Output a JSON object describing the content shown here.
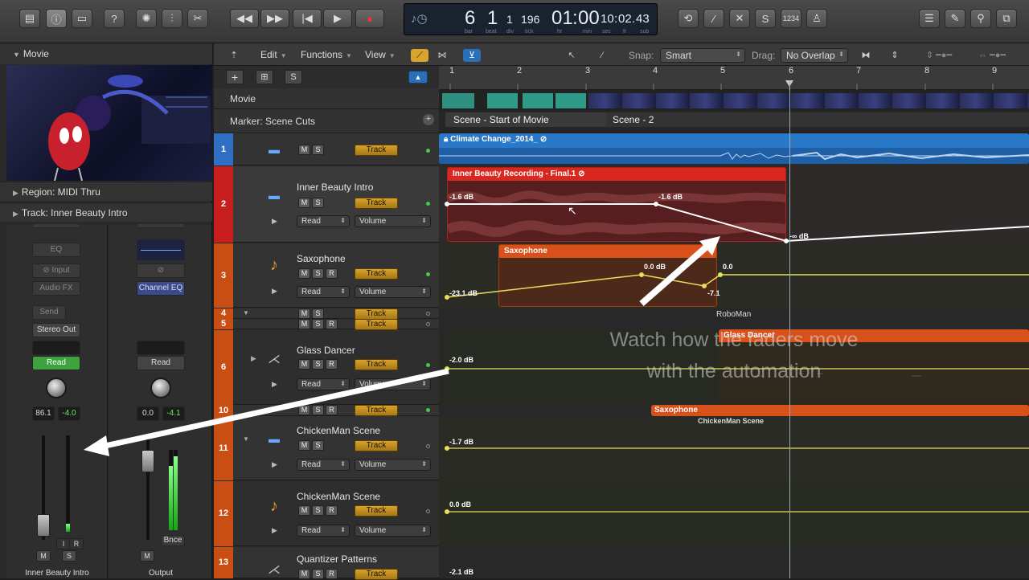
{
  "toolbar": {
    "lcd": {
      "bar": "6",
      "beat": "1",
      "div": "1",
      "tick": "196",
      "hr": "01",
      "min": "00",
      "sec": "10",
      "fr": "02",
      "sub": "43",
      "labels": {
        "bar": "bar",
        "beat": "beat",
        "div": "div",
        "tick": "tick",
        "hr": "hr",
        "min": "min",
        "sec": "sec",
        "fr": "fr",
        "sub": "sub"
      }
    },
    "counter": "1234"
  },
  "left_panel": {
    "movie_header": "Movie",
    "region": "Region: MIDI Thru",
    "track": "Track:  Inner Beauty Intro",
    "strip1": {
      "eq": "EQ",
      "input": "Input",
      "audio_fx": "Audio FX",
      "send": "Send",
      "output": "Stereo Out",
      "mode": "Read",
      "pan": "86.1",
      "gain": "-4.0",
      "mute": "M",
      "solo": "S",
      "name": "Inner Beauty Intro",
      "i": "I",
      "r": "R"
    },
    "strip2": {
      "eq": "Channel EQ",
      "mode": "Read",
      "pan": "0.0",
      "gain": "-4.1",
      "mute": "M",
      "bounce": "Bnce",
      "name": "Output"
    }
  },
  "tracks_toolbar": {
    "edit": "Edit",
    "functions": "Functions",
    "view": "View",
    "snap_label": "Snap:",
    "snap": "Smart",
    "drag_label": "Drag:",
    "drag": "No Overlap"
  },
  "header_buttons": {
    "plus": "+",
    "s": "S"
  },
  "global_tracks": {
    "movie": "Movie",
    "marker": "Marker: Scene Cuts"
  },
  "tracks": [
    {
      "num": "1",
      "name": "",
      "m": "M",
      "s": "S",
      "btn": "Track",
      "color": "#2f6fc4"
    },
    {
      "num": "2",
      "name": "Inner Beauty Intro",
      "m": "M",
      "s": "S",
      "btn": "Track",
      "mode": "Read",
      "param": "Volume",
      "color": "#d02020"
    },
    {
      "num": "3",
      "name": "Saxophone",
      "m": "M",
      "s": "S",
      "r": "R",
      "btn": "Track",
      "mode": "Read",
      "param": "Volume",
      "color": "#c84e14"
    },
    {
      "num": "4",
      "m": "M",
      "s": "S",
      "btn": "Track",
      "color": "#c84e14"
    },
    {
      "num": "5",
      "m": "M",
      "s": "S",
      "r": "R",
      "btn": "Track",
      "color": "#c84e14"
    },
    {
      "num": "6",
      "name": "Glass Dancer",
      "m": "M",
      "s": "S",
      "r": "R",
      "btn": "Track",
      "mode": "Read",
      "param": "Volume",
      "color": "#c84e14"
    },
    {
      "num": "10",
      "m": "M",
      "s": "S",
      "r": "R",
      "btn": "Track",
      "color": "#c84e14"
    },
    {
      "num": "11",
      "name": "ChickenMan Scene",
      "m": "M",
      "s": "S",
      "btn": "Track",
      "mode": "Read",
      "param": "Volume",
      "color": "#c84e14"
    },
    {
      "num": "12",
      "name": "ChickenMan Scene",
      "m": "M",
      "s": "S",
      "r": "R",
      "btn": "Track",
      "mode": "Read",
      "param": "Volume",
      "color": "#c84e14"
    },
    {
      "num": "13",
      "name": "Quantizer Patterns",
      "m": "M",
      "s": "S",
      "r": "R",
      "btn": "Track",
      "color": "#c84e14"
    }
  ],
  "ruler": {
    "bars": [
      "1",
      "2",
      "3",
      "4",
      "5",
      "6",
      "7",
      "8",
      "9"
    ]
  },
  "markers": {
    "m1": "Scene - Start of Movie",
    "m2": "Scene - 2"
  },
  "regions": {
    "climate": "Climate Change_2014_",
    "inner": "Inner Beauty Recording - Final.1",
    "sax": "Saxophone",
    "glass": "Glass Dancer",
    "sax2": "Saxophone",
    "roboman": "RoboMan",
    "chicken": "ChickenMan Scene"
  },
  "automation_labels": {
    "a1": "-1.6 dB",
    "a2": "-1.6 dB",
    "a3": "-∞ dB",
    "b1": "-23.1 dB",
    "b2": "0.0 dB",
    "b3": "-7.1",
    "b4": "0.0",
    "c1": "-2.0 dB",
    "d1": "-1.7 dB",
    "e1": "0.0 dB",
    "f1": "-2.1 dB"
  },
  "caption": {
    "line1": "Watch how the faders move",
    "line2": "with the automation"
  },
  "colors": {
    "blue_region": "#2a78c8",
    "red_region": "#d82820",
    "orange_region": "#d8501a",
    "automation_white": "#ffffff",
    "automation_yellow": "#e8e05a"
  }
}
